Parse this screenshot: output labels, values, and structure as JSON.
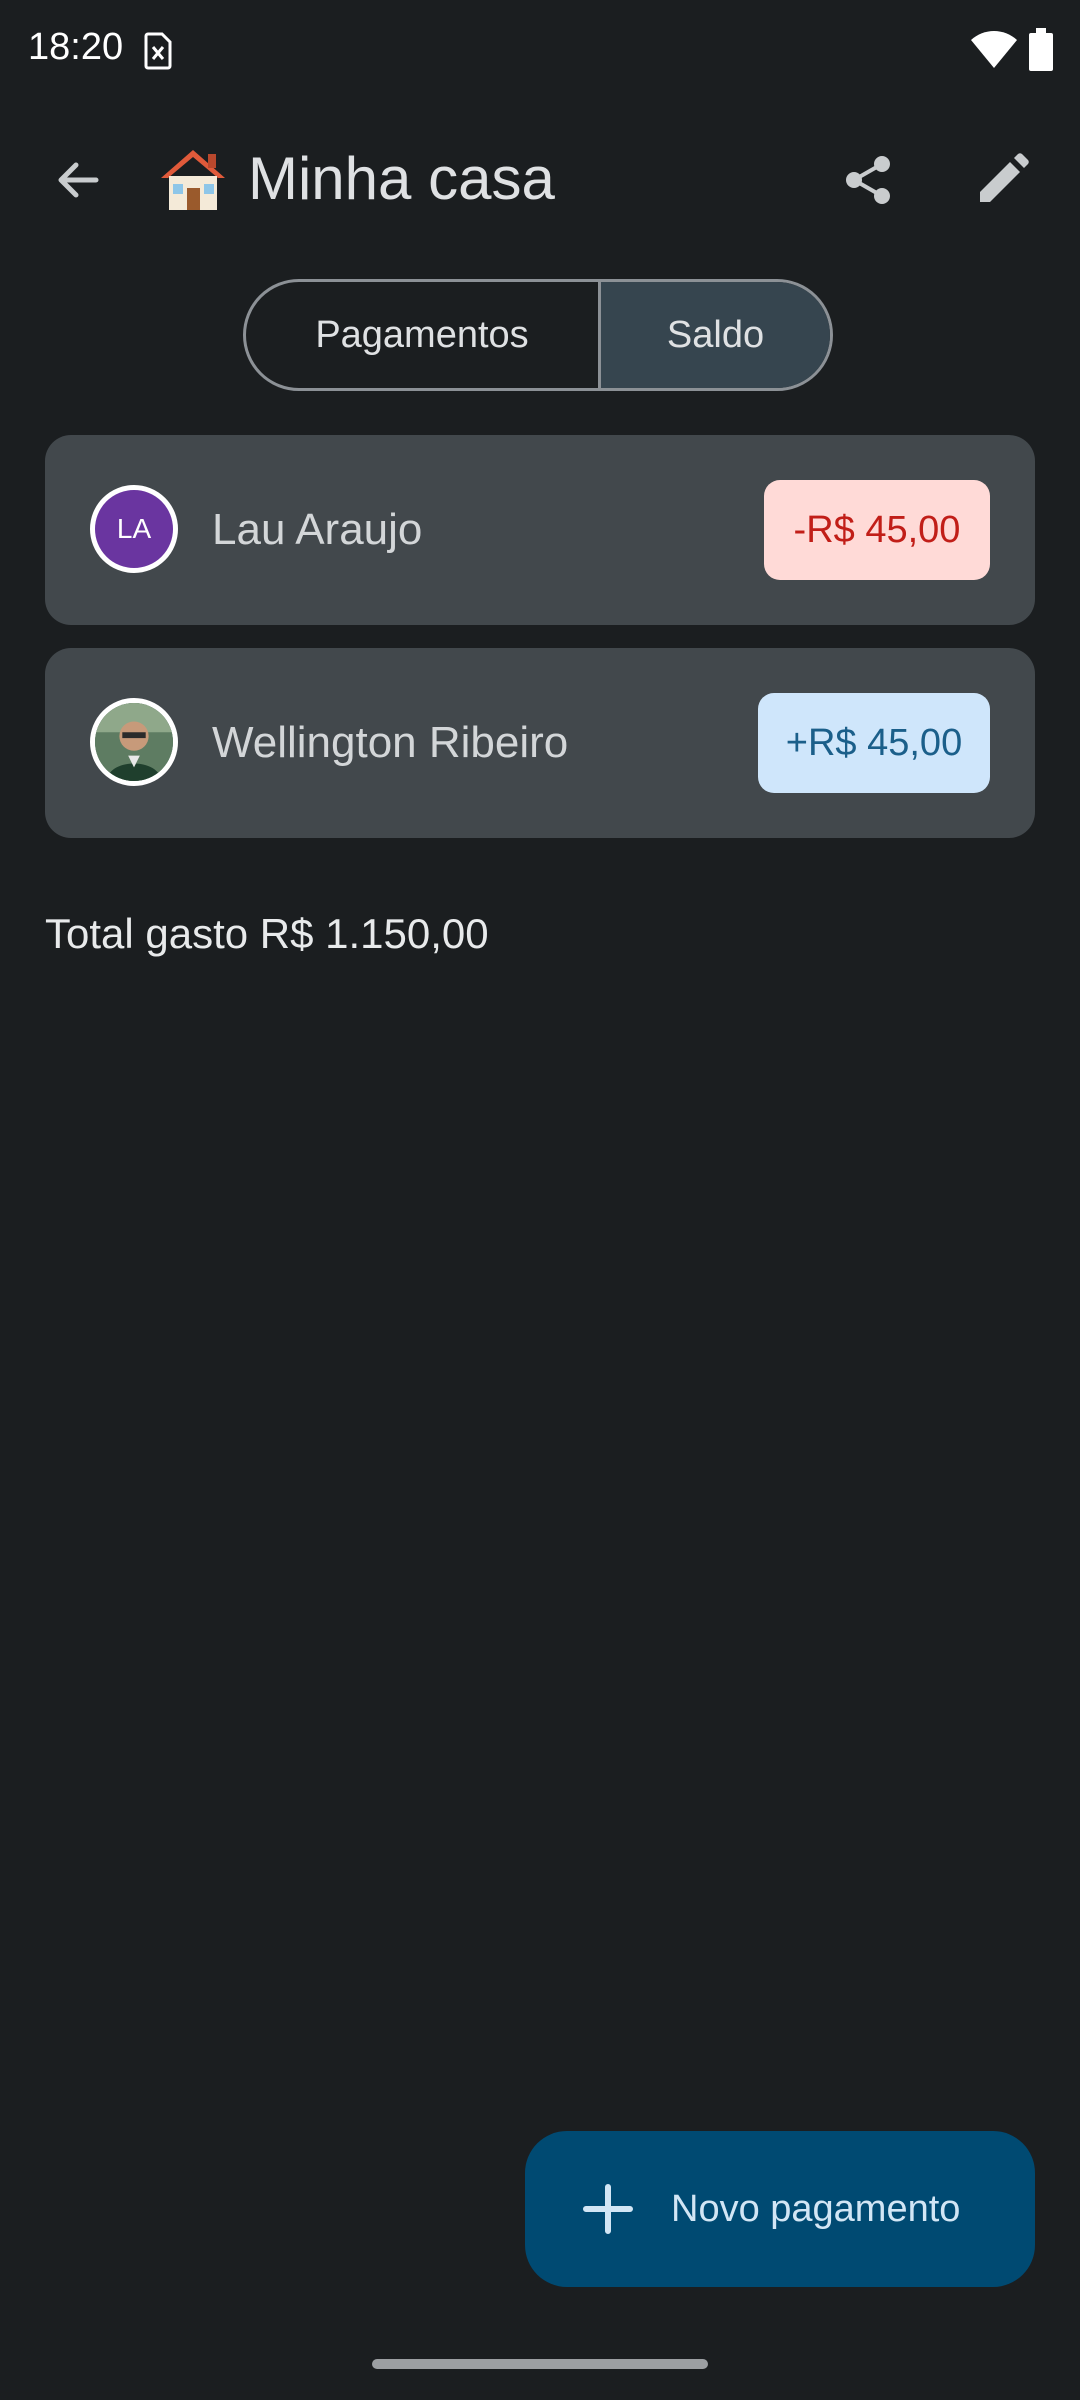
{
  "status_bar": {
    "time": "18:20",
    "icons": [
      "sim-card-alert-icon",
      "wifi-icon",
      "battery-icon"
    ]
  },
  "app_bar": {
    "title_emoji": "house-emoji-icon",
    "title": "Minha casa",
    "actions": [
      "back-arrow-icon",
      "share-icon",
      "edit-pencil-icon"
    ]
  },
  "tabs": {
    "pagamentos": "Pagamentos",
    "saldo": "Saldo",
    "selected": "Saldo"
  },
  "balances": [
    {
      "initials": "LA",
      "name": "Lau Araujo",
      "amount": "-R$ 45,00",
      "status": "negative"
    },
    {
      "initials": "",
      "name": "Wellington Ribeiro",
      "amount": "+R$ 45,00",
      "status": "positive"
    }
  ],
  "total_text": "Total gasto R$ 1.150,00",
  "fab": {
    "icon": "plus-icon",
    "label": "Novo pagamento"
  },
  "colors": {
    "background": "#1b1e20",
    "card": "#42484c",
    "negative_bg": "#ffdad7",
    "negative_text": "#c11e18",
    "positive_bg": "#cfe6fb",
    "positive_text": "#1b5f8a",
    "fab": "#004a72",
    "avatar_la": "#6a35a0",
    "selected_tab": "#36454f"
  }
}
